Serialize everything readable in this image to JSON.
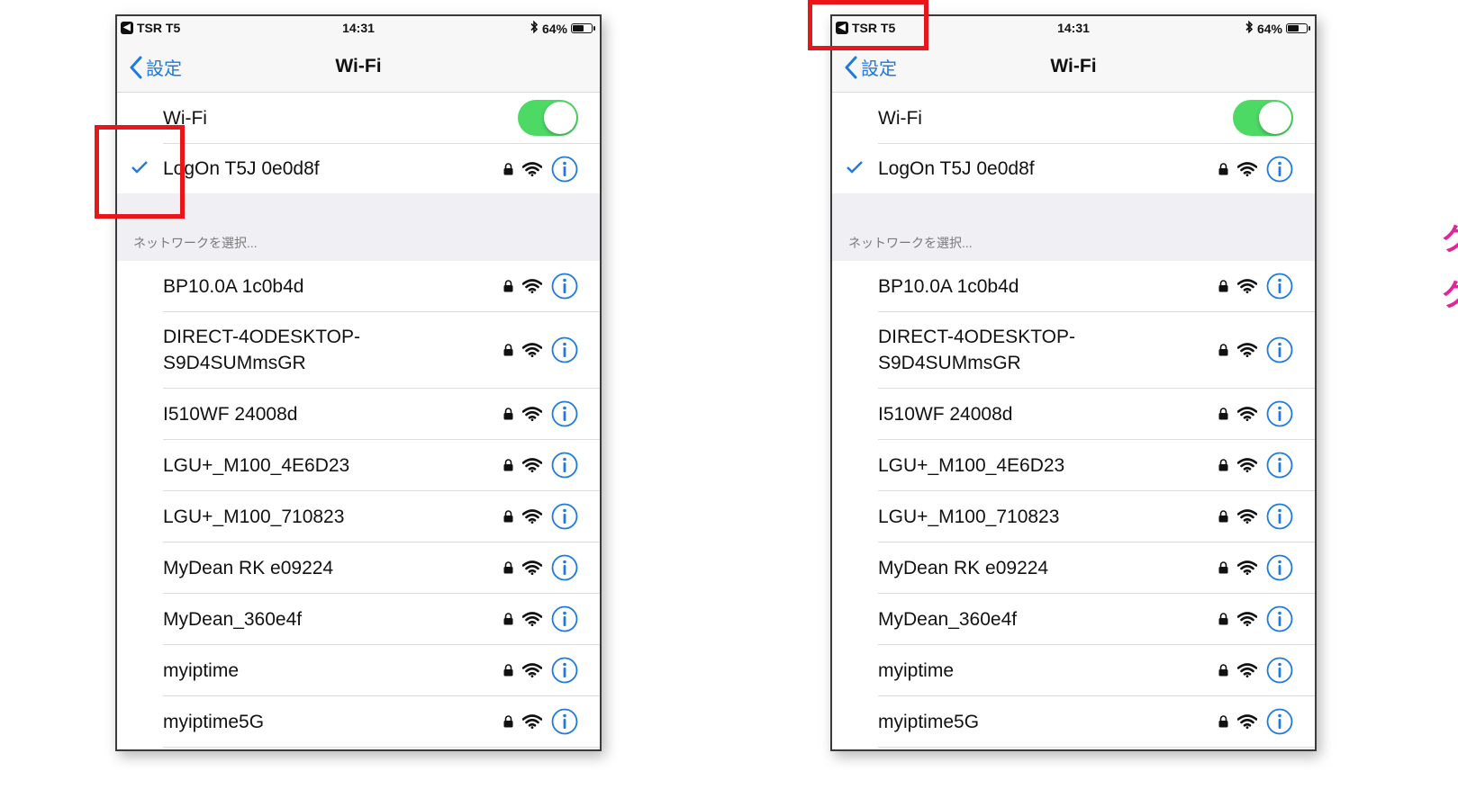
{
  "status_bar": {
    "carrier": "TSR T5",
    "time": "14:31",
    "battery_percent": "64%",
    "battery_level": 0.64
  },
  "nav": {
    "back_label": "設定",
    "title": "Wi-Fi"
  },
  "wifi_toggle": {
    "label": "Wi-Fi",
    "on": true
  },
  "connected_network": "LogOn T5J 0e0d8f",
  "section_header": "ネットワークを選択...",
  "networks": [
    "BP10.0A 1c0b4d",
    "DIRECT-4ODESKTOP-S9D4SUMmsGR",
    "I510WF 24008d",
    "LGU+_M100_4E6D23",
    "LGU+_M100_710823",
    "MyDean RK e09224",
    "MyDean_360e4f",
    "myiptime",
    "myiptime5G"
  ],
  "network_line_breaks": {
    "DIRECT-4ODESKTOP-S9D4SUMmsGR": [
      "DIRECT-4ODESKTOP-",
      "S9D4SUMmsGR"
    ]
  },
  "colors": {
    "accent": "#1f7ae0",
    "toggle_on": "#4cd964",
    "highlight": "#e8151a",
    "pink": "#e0269a"
  }
}
